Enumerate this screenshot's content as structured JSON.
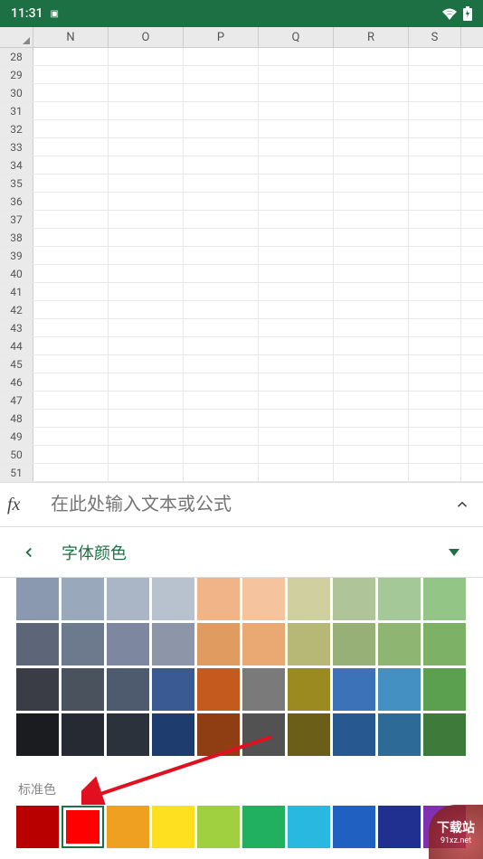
{
  "status_bar": {
    "time": "11:31",
    "app_indicator": "▣"
  },
  "spreadsheet": {
    "columns": [
      "N",
      "O",
      "P",
      "Q",
      "R",
      "S"
    ],
    "row_start": 28,
    "row_end": 51
  },
  "formula_bar": {
    "fx_label": "fx",
    "placeholder": "在此处输入文本或公式"
  },
  "panel": {
    "title": "字体颜色"
  },
  "color_grid": {
    "rows": [
      [
        "#8b99b0",
        "#9aa8bc",
        "#aab6c6",
        "#b8c2ce",
        "#f0b488",
        "#f5c39e",
        "#d0cfa0",
        "#b0c49a",
        "#a5c898",
        "#93c686"
      ],
      [
        "#5c6678",
        "#6d7a8e",
        "#7d88a0",
        "#8d96a8",
        "#e09c60",
        "#eaa872",
        "#b8b876",
        "#96b078",
        "#8eb572",
        "#7db266"
      ],
      [
        "#3a3d46",
        "#4a525e",
        "#4e5a6e",
        "#3a5a94",
        "#c55a1e",
        "#7a7a7a",
        "#9a8a20",
        "#3c72b8",
        "#4490c2",
        "#5aa04e"
      ],
      [
        "#1a1c20",
        "#262a32",
        "#2c323c",
        "#1e3c6e",
        "#8f3e14",
        "#525252",
        "#6a5e18",
        "#285890",
        "#2e6a98",
        "#3e7a3a"
      ]
    ]
  },
  "standard_colors": {
    "label": "标准色",
    "colors": [
      "#b80000",
      "#ff0000",
      "#f0a020",
      "#ffe020",
      "#a0d040",
      "#20b060",
      "#28b8e0",
      "#2060c0",
      "#203090",
      "#8030b0"
    ],
    "selected_index": 1
  },
  "watermark": {
    "title": "下载站",
    "url": "91xz.net"
  }
}
